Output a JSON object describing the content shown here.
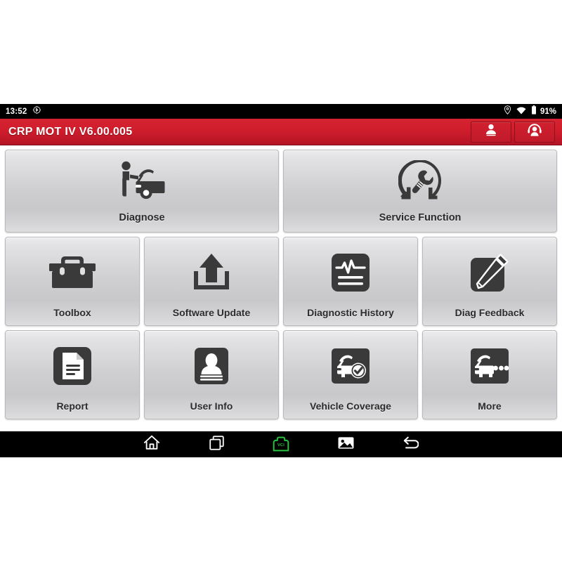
{
  "status_bar": {
    "time": "13:52",
    "bluetooth_icon": "bluetooth-circle-icon",
    "location_icon": "location-pin-icon",
    "wifi_icon": "wifi-icon",
    "battery_icon": "battery-icon",
    "battery_percent": "91%"
  },
  "header": {
    "title": "CRP MOT IV V6.00.005",
    "background_color": "#cf1d2c",
    "actions": [
      {
        "name": "user-account-button",
        "icon": "user-icon"
      },
      {
        "name": "support-agent-button",
        "icon": "headset-user-icon"
      }
    ]
  },
  "tiles": {
    "row_large": [
      {
        "label": "Diagnose",
        "icon": "mechanic-car-icon"
      },
      {
        "label": "Service Function",
        "icon": "wrench-refresh-icon"
      }
    ],
    "row_middle": [
      {
        "label": "Toolbox",
        "icon": "toolbox-icon"
      },
      {
        "label": "Software Update",
        "icon": "upload-arrow-icon"
      },
      {
        "label": "Diagnostic History",
        "icon": "waveform-document-icon"
      },
      {
        "label": "Diag Feedback",
        "icon": "pencil-icon"
      }
    ],
    "row_bottom": [
      {
        "label": "Report",
        "icon": "document-icon"
      },
      {
        "label": "User Info",
        "icon": "id-person-icon"
      },
      {
        "label": "Vehicle Coverage",
        "icon": "car-check-icon"
      },
      {
        "label": "More",
        "icon": "car-ellipsis-icon"
      }
    ]
  },
  "nav_bar": {
    "items": [
      {
        "name": "home-button",
        "icon": "home-icon"
      },
      {
        "name": "recents-button",
        "icon": "recent-apps-icon"
      },
      {
        "name": "vci-button",
        "icon": "vci-connector-icon",
        "label": "VCI",
        "color": "#25c43a"
      },
      {
        "name": "screenshot-button",
        "icon": "image-icon"
      },
      {
        "name": "back-button",
        "icon": "back-arrow-icon"
      }
    ]
  }
}
